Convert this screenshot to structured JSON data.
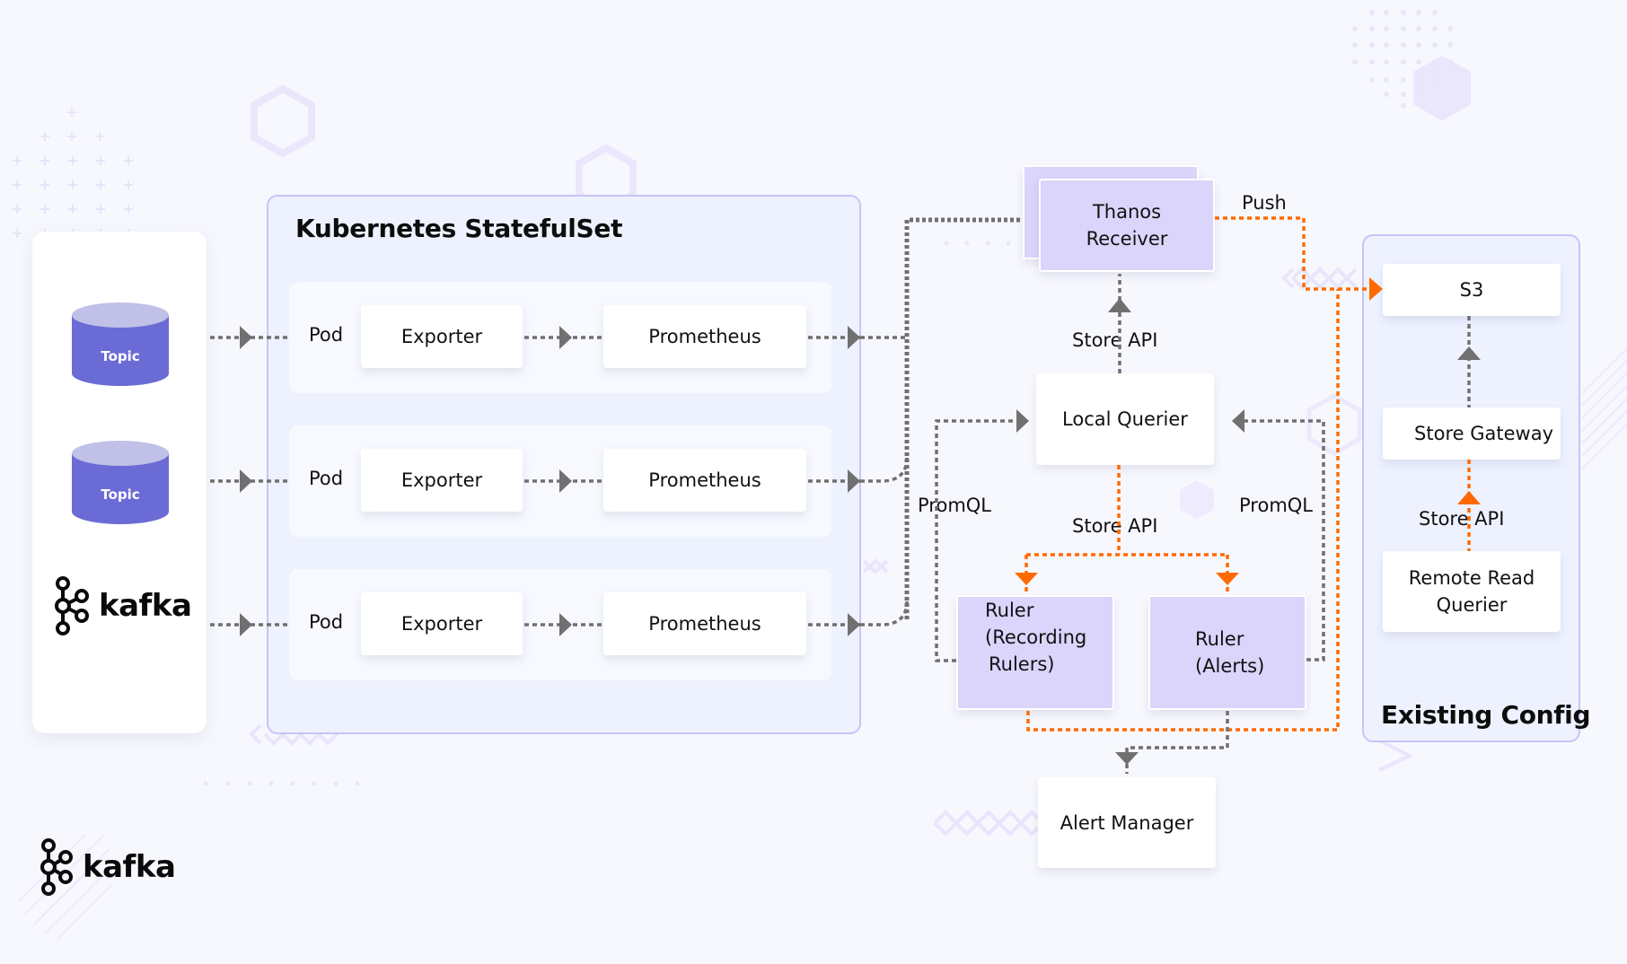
{
  "diagram": {
    "source_panel": {
      "topics": [
        {
          "label": "Topic"
        },
        {
          "label": "Topic"
        }
      ],
      "logo_text": "kafka"
    },
    "statefulset": {
      "title": "Kubernetes StatefulSet",
      "pods": [
        {
          "pod_label": "Pod",
          "exporter": "Exporter",
          "prometheus": "Prometheus"
        },
        {
          "pod_label": "Pod",
          "exporter": "Exporter",
          "prometheus": "Prometheus"
        },
        {
          "pod_label": "Pod",
          "exporter": "Exporter",
          "prometheus": "Prometheus"
        }
      ]
    },
    "thanos": {
      "receiver_line1": "Thanos",
      "receiver_line2": "Receiver",
      "push_label": "Push",
      "store_api_top": "Store API",
      "local_querier": "Local Querier",
      "promql_left": "PromQL",
      "promql_right": "PromQL",
      "store_api_mid": "Store API",
      "ruler_recording_line1": "Ruler",
      "ruler_recording_line2": "(Recording",
      "ruler_recording_line3": "Rulers)",
      "ruler_alerts_line1": "Ruler",
      "ruler_alerts_line2": "(Alerts)",
      "alert_manager": "Alert Manager"
    },
    "existing_config": {
      "title": "Existing Config",
      "s3": "S3",
      "store_gateway": "Store Gateway",
      "store_api": "Store API",
      "remote_read_line1": "Remote Read",
      "remote_read_line2": "Querier"
    },
    "footer_logo_text": "kafka",
    "colors": {
      "gray_flow": "#707070",
      "orange_flow": "#FF6A00",
      "topic_body": "#6B6BD6",
      "topic_top": "#C0C0E8",
      "ruler_fill": "#DBD4FB",
      "group_border": "#C9C3F6",
      "group_fill": "#EEF2FF"
    }
  }
}
